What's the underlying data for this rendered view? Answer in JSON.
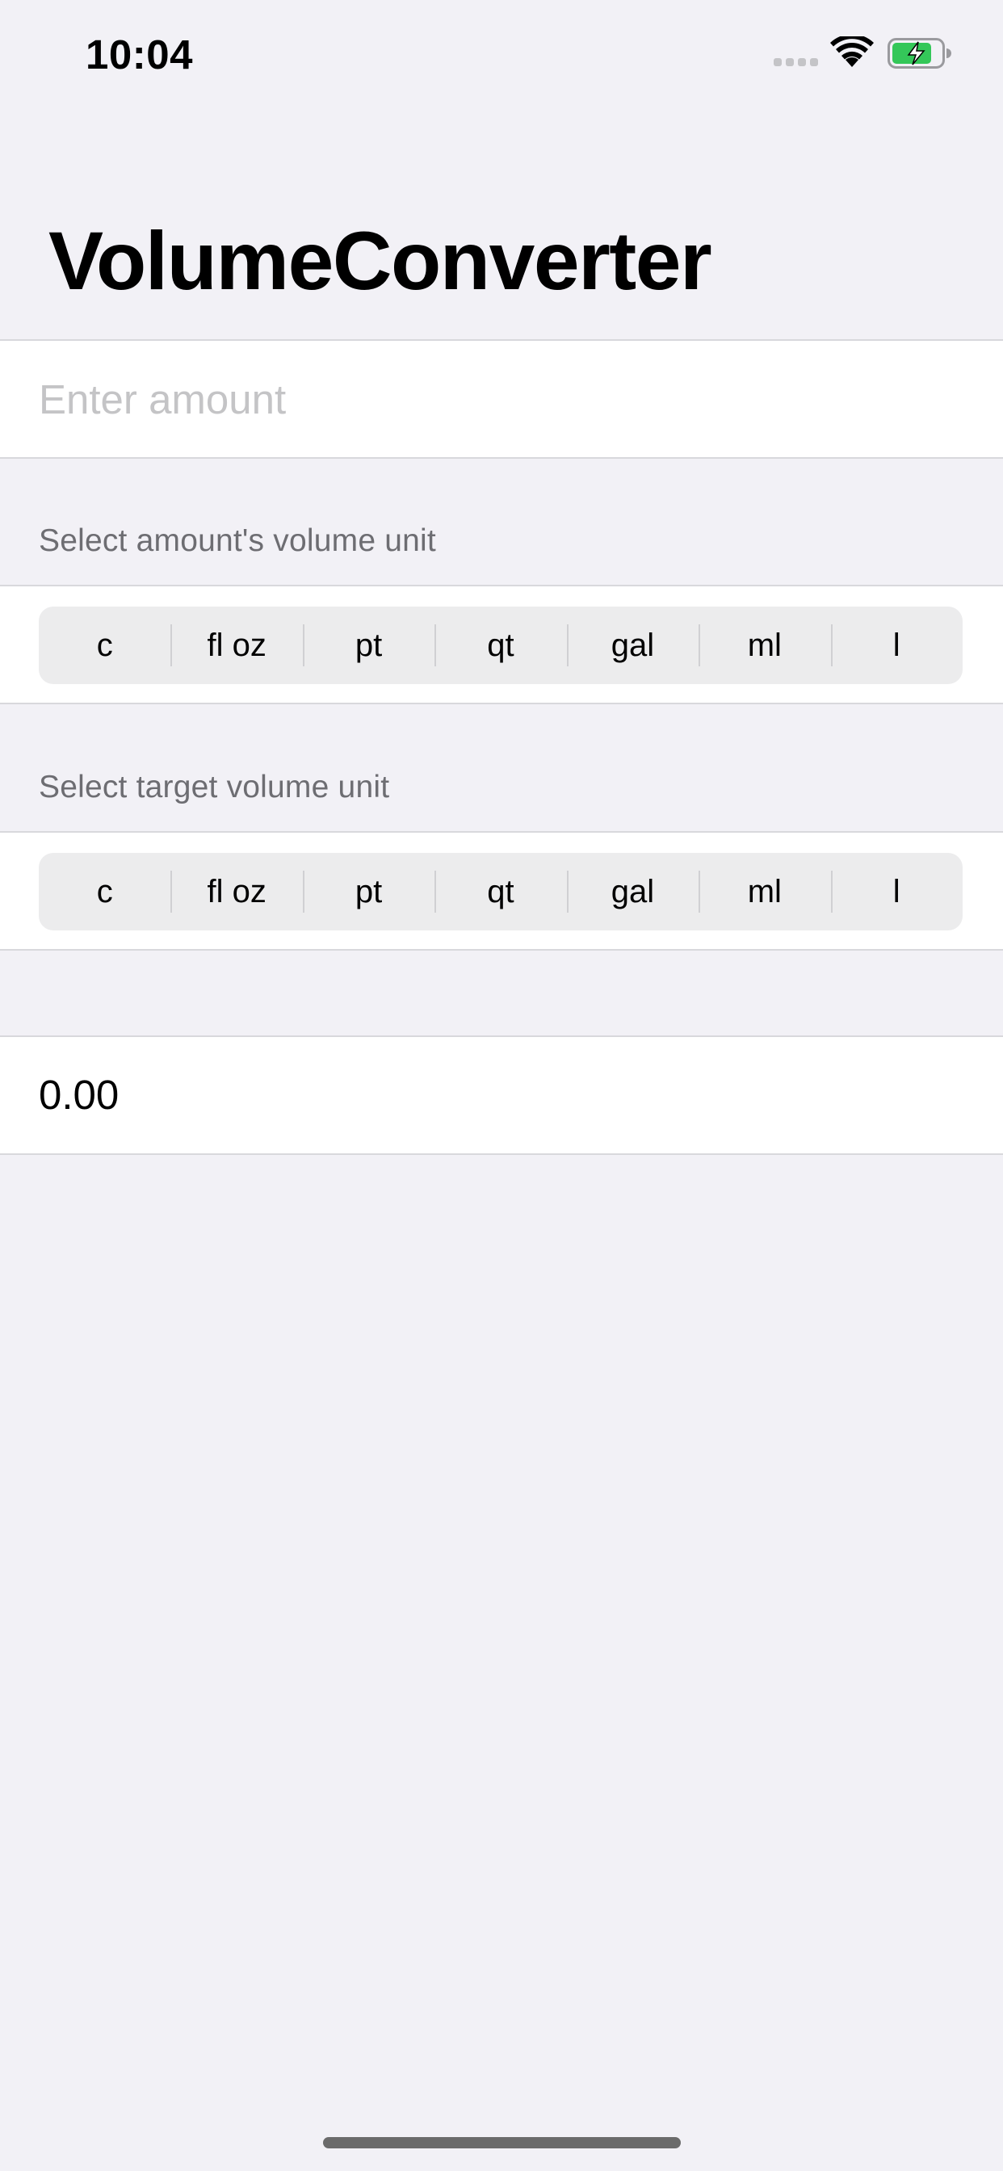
{
  "status_bar": {
    "time": "10:04",
    "signal_icon": "cellular-signal-icon",
    "wifi_icon": "wifi-icon",
    "battery_icon": "battery-charging-icon",
    "battery_color": "#34c759"
  },
  "navigation": {
    "title": "VolumeConverter"
  },
  "amount": {
    "placeholder": "Enter amount",
    "value": ""
  },
  "source_unit": {
    "header": "Select amount's volume unit",
    "options": [
      "c",
      "fl oz",
      "pt",
      "qt",
      "gal",
      "ml",
      "l"
    ]
  },
  "target_unit": {
    "header": "Select target volume unit",
    "options": [
      "c",
      "fl oz",
      "pt",
      "qt",
      "gal",
      "ml",
      "l"
    ]
  },
  "result": {
    "value": "0.00"
  },
  "colors": {
    "background": "#f2f1f6",
    "secondary_text": "#6d6d72",
    "placeholder_text": "#c4c4c6"
  }
}
